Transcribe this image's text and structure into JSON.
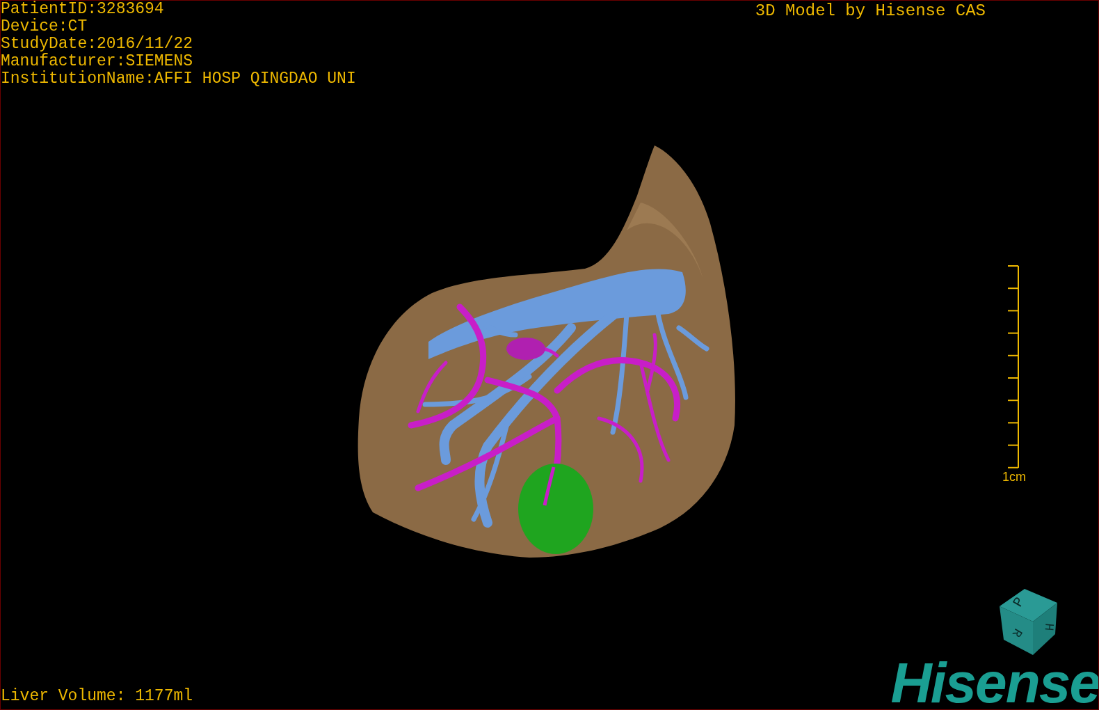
{
  "header": {
    "patient_info": [
      "PatientID:3283694",
      "Device:CT",
      "StudyDate:2016/11/22",
      "Manufacturer:SIEMENS",
      "InstitutionName:AFFI HOSP QINGDAO UNI"
    ],
    "title": "3D Model by Hisense CAS"
  },
  "scale_bar": {
    "label": "1cm"
  },
  "orientation_cube": {
    "faces": [
      "P",
      "H",
      "R"
    ]
  },
  "footer": {
    "liver_volume": "Liver Volume: 1177ml",
    "logo": "Hisense"
  }
}
